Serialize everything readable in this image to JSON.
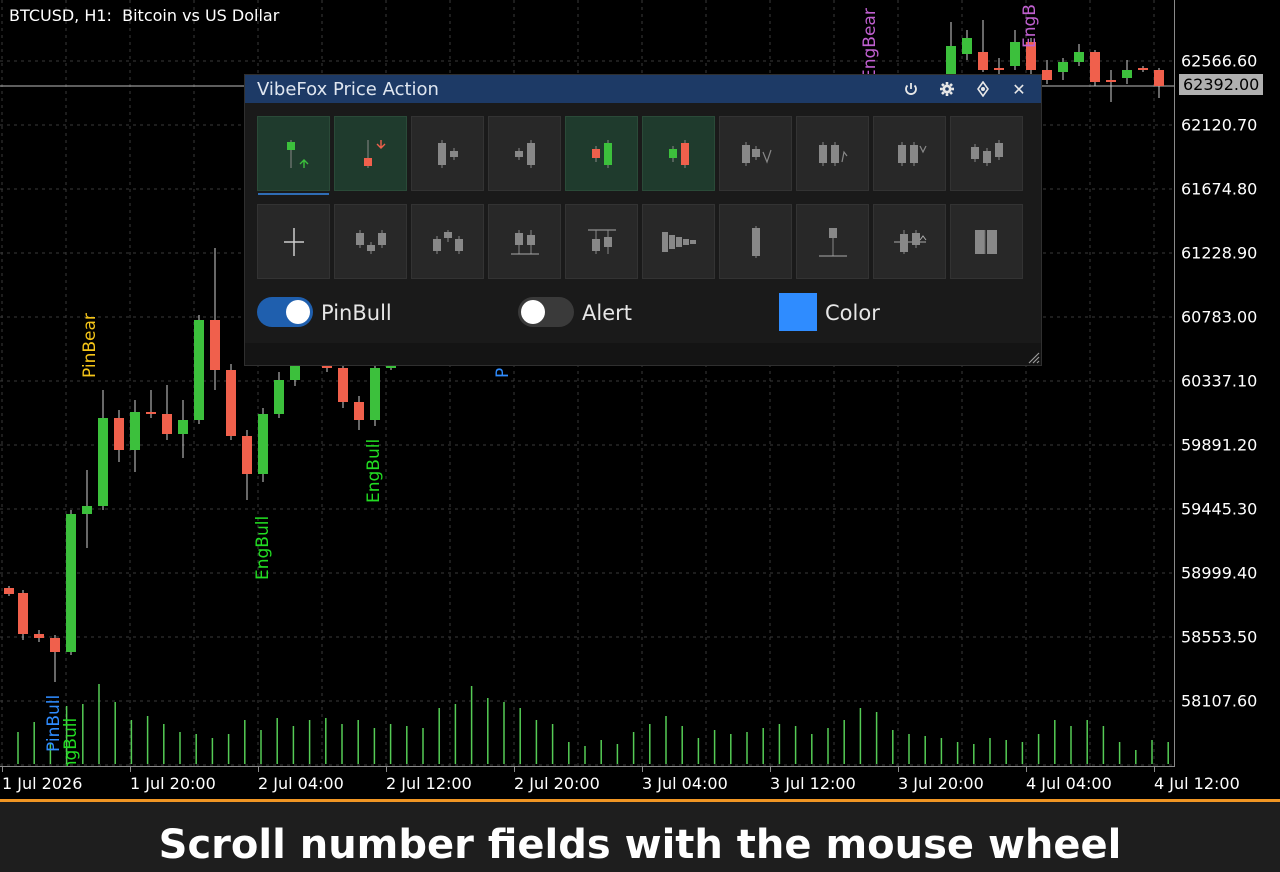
{
  "chart": {
    "symbol_title": "BTCUSD, H1:  Bitcoin vs US Dollar",
    "current_price": "62392.00",
    "price_labels": [
      "62566.60",
      "62120.70",
      "61674.80",
      "61228.90",
      "60783.00",
      "60337.10",
      "59891.20",
      "59445.30",
      "58999.40",
      "58553.50",
      "58107.60"
    ],
    "time_labels": [
      "1 Jul 2026",
      "1 Jul 20:00",
      "2 Jul 04:00",
      "2 Jul 12:00",
      "2 Jul 20:00",
      "3 Jul 04:00",
      "3 Jul 12:00",
      "3 Jul 20:00",
      "4 Jul 04:00",
      "4 Jul 12:00"
    ],
    "pattern_labels": [
      {
        "text": "PinBear",
        "color": "#f5c518"
      },
      {
        "text": "PinBull",
        "color": "#2f8cff"
      },
      {
        "text": "EngBull",
        "color": "#22dd22"
      },
      {
        "text": "EngBull",
        "color": "#22dd22"
      },
      {
        "text": "EngBull",
        "color": "#22dd22"
      },
      {
        "text": "EngBear",
        "color": "#c060d0"
      },
      {
        "text": "EngB",
        "color": "#c060d0"
      },
      {
        "text": "P",
        "color": "#2f8cff"
      }
    ],
    "colors": {
      "bull": "#3cc03c",
      "bear": "#f0604c",
      "volume": "#55cc55",
      "grid": "#3a3a3a",
      "crosshair": "#bcbcbc"
    }
  },
  "panel": {
    "title": "VibeFox Price Action",
    "controls": {
      "power": "power-icon",
      "settings": "gear-icon",
      "move": "move-icon",
      "close": "close-icon",
      "close_glyph": "✕"
    },
    "row1": [
      "pin-bull",
      "pin-bear",
      "inside-bar",
      "outside-bar",
      "engulfing-bull",
      "engulfing-bear",
      "three-bar-down",
      "three-bar-up",
      "double-bar",
      "three-soldiers"
    ],
    "row2": [
      "doji",
      "morning-star",
      "evening-star",
      "tweezer-bottom",
      "tweezer-top",
      "squeeze",
      "long-candle",
      "hammer",
      "piercing",
      "harami"
    ],
    "row1_active": [
      true,
      true,
      false,
      false,
      true,
      true,
      false,
      false,
      false,
      false
    ],
    "toggles": {
      "pinbull_label": "PinBull",
      "pinbull_on": true,
      "alert_label": "Alert",
      "alert_on": false,
      "color_label": "Color",
      "color_value": "#2f8cff"
    }
  },
  "caption": "Scroll number fields with the mouse wheel"
}
